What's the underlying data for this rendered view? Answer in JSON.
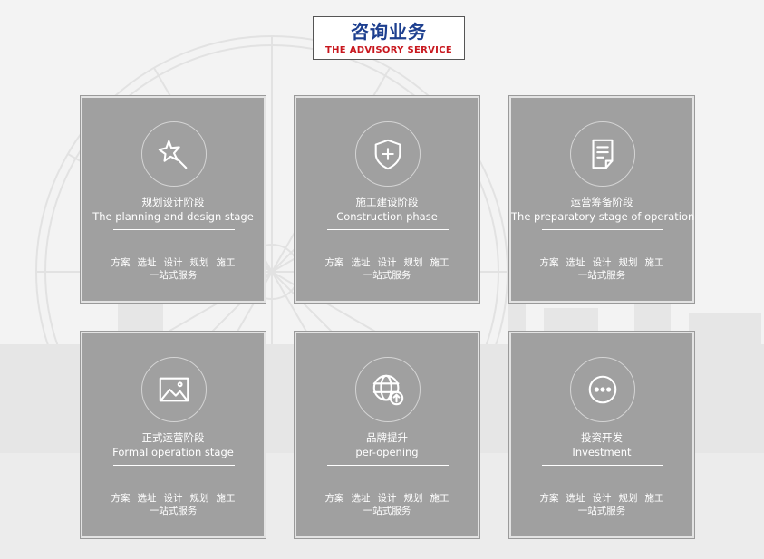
{
  "header": {
    "title_cn": "咨询业务",
    "title_en": "THE ADVISORY SERVICE"
  },
  "colors": {
    "title_blue": "#1d3f8f",
    "title_red": "#c8171e",
    "card_bg": "#a0a0a0"
  },
  "cards": [
    {
      "icon": "magic-wand-icon",
      "title_cn": "规划设计阶段",
      "title_en": "The planning and design stage",
      "services": [
        "方案",
        "选址",
        "设计",
        "规划",
        "施工"
      ],
      "one_stop": "一站式服务"
    },
    {
      "icon": "shield-plus-icon",
      "title_cn": "施工建设阶段",
      "title_en": "Construction phase",
      "services": [
        "方案",
        "选址",
        "设计",
        "规划",
        "施工"
      ],
      "one_stop": "一站式服务"
    },
    {
      "icon": "document-icon",
      "title_cn": "运营筹备阶段",
      "title_en": "The preparatory stage of operation",
      "services": [
        "方案",
        "选址",
        "设计",
        "规划",
        "施工"
      ],
      "one_stop": "一站式服务"
    },
    {
      "icon": "image-icon",
      "title_cn": "正式运营阶段",
      "title_en": "Formal operation stage",
      "services": [
        "方案",
        "选址",
        "设计",
        "规划",
        "施工"
      ],
      "one_stop": "一站式服务"
    },
    {
      "icon": "globe-upload-icon",
      "title_cn": "品牌提升",
      "title_en": "per-opening",
      "services": [
        "方案",
        "选址",
        "设计",
        "规划",
        "施工"
      ],
      "one_stop": "一站式服务"
    },
    {
      "icon": "more-dots-icon",
      "title_cn": "投资开发",
      "title_en": "Investment",
      "services": [
        "方案",
        "选址",
        "设计",
        "规划",
        "施工"
      ],
      "one_stop": "一站式服务"
    }
  ]
}
